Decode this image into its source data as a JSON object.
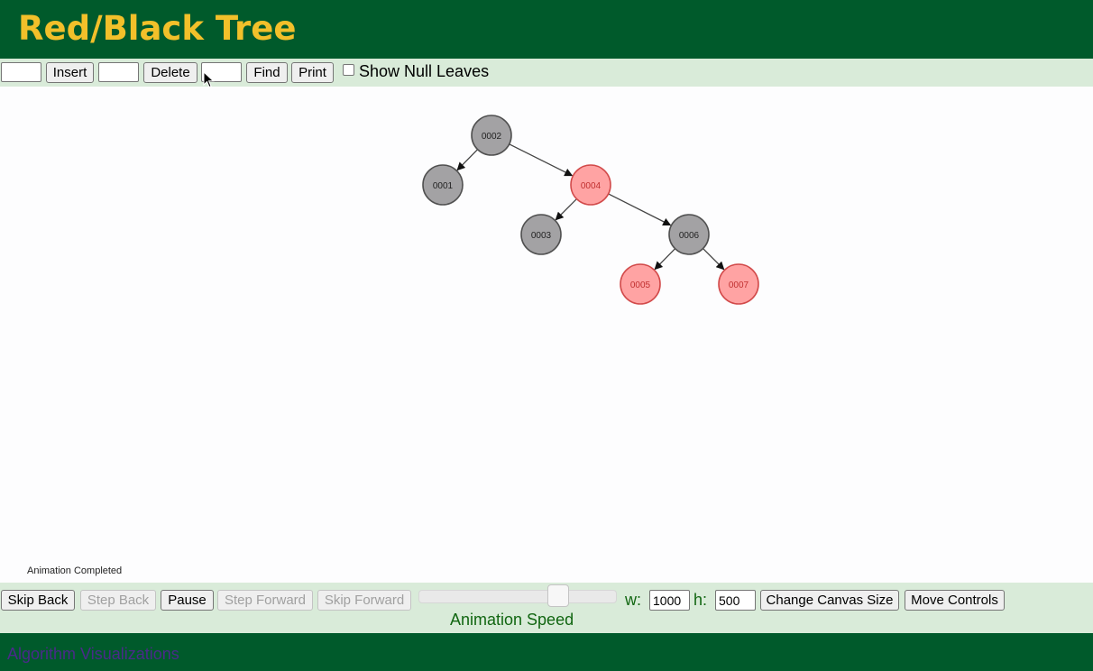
{
  "header": {
    "title": "Red/Black Tree"
  },
  "toolbar": {
    "insert_label": "Insert",
    "delete_label": "Delete",
    "find_label": "Find",
    "print_label": "Print",
    "show_null_leaves_label": "Show Null Leaves",
    "show_null_leaves_checked": false,
    "insert_value": "",
    "delete_value": "",
    "find_value": ""
  },
  "tree": {
    "nodes": [
      {
        "key": "0002",
        "color": "black"
      },
      {
        "key": "0001",
        "color": "black"
      },
      {
        "key": "0004",
        "color": "red"
      },
      {
        "key": "0003",
        "color": "black"
      },
      {
        "key": "0006",
        "color": "black"
      },
      {
        "key": "0005",
        "color": "red"
      },
      {
        "key": "0007",
        "color": "red"
      }
    ],
    "edges": [
      [
        "0002",
        "0001"
      ],
      [
        "0002",
        "0004"
      ],
      [
        "0004",
        "0003"
      ],
      [
        "0004",
        "0006"
      ],
      [
        "0006",
        "0005"
      ],
      [
        "0006",
        "0007"
      ]
    ],
    "colors": {
      "black_fill": "#a3a2a4",
      "black_stroke": "#505050",
      "black_text": "#222222",
      "red_fill": "#ffa3a3",
      "red_stroke": "#d24a4a",
      "red_text": "#c03030"
    }
  },
  "status": {
    "message": "Animation Completed"
  },
  "controls": {
    "skip_back_label": "Skip Back",
    "step_back_label": "Step Back",
    "pause_label": "Pause",
    "step_forward_label": "Step Forward",
    "skip_forward_label": "Skip Forward",
    "speed_label": "Animation Speed",
    "speed_level": 0.73,
    "w_label": "w:",
    "w_value": "1000",
    "h_label": "h:",
    "h_value": "500",
    "change_canvas_label": "Change Canvas Size",
    "move_controls_label": "Move Controls"
  },
  "footer": {
    "link_text": "Algorithm Visualizations"
  },
  "theme": {
    "header_bg": "#005a2b",
    "title_color": "#f2c02a",
    "bar_bg": "#d9ebd9",
    "label_green": "#116611"
  }
}
